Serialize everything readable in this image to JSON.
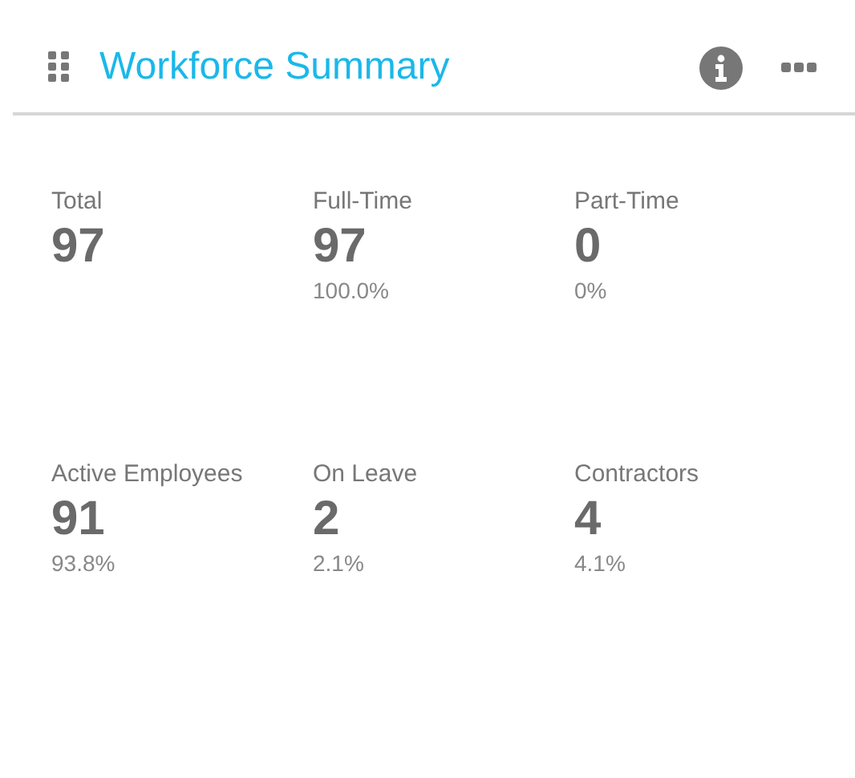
{
  "header": {
    "title": "Workforce Summary"
  },
  "stats": [
    {
      "label": "Total",
      "value": "97"
    },
    {
      "label": "Full-Time",
      "value": "97",
      "percent": "100.0%"
    },
    {
      "label": "Part-Time",
      "value": "0",
      "percent": "0%"
    },
    {
      "label": "Active Employees",
      "value": "91",
      "percent": "93.8%"
    },
    {
      "label": "On Leave",
      "value": "2",
      "percent": "2.1%"
    },
    {
      "label": "Contractors",
      "value": "4",
      "percent": "4.1%"
    }
  ]
}
